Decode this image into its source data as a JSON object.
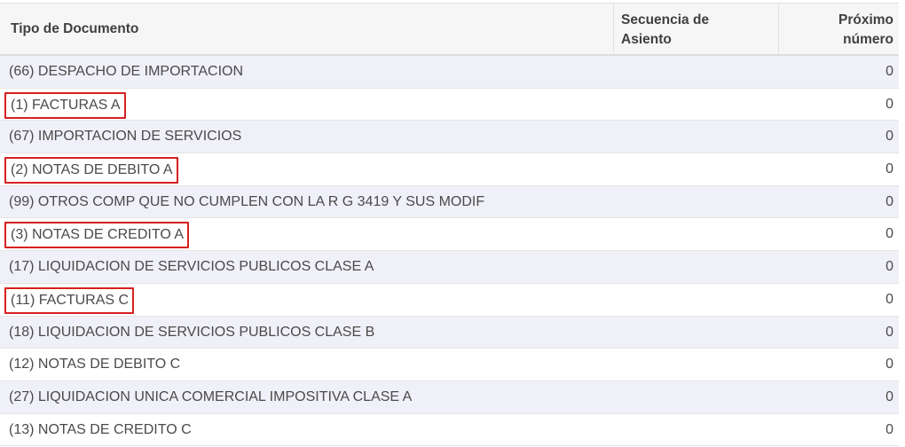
{
  "table": {
    "columns": {
      "doc_type": "Tipo de Documento",
      "sequence": [
        "Secuencia de",
        "Asiento"
      ],
      "next_number": [
        "Próximo",
        "número"
      ]
    },
    "rows": [
      {
        "doc": "(66) DESPACHO DE IMPORTACION",
        "sequence": "",
        "next": "0",
        "highlighted": false
      },
      {
        "doc": "(1) FACTURAS A",
        "sequence": "",
        "next": "0",
        "highlighted": true
      },
      {
        "doc": "(67) IMPORTACION DE SERVICIOS",
        "sequence": "",
        "next": "0",
        "highlighted": false
      },
      {
        "doc": "(2) NOTAS DE DEBITO A",
        "sequence": "",
        "next": "0",
        "highlighted": true
      },
      {
        "doc": "(99) OTROS COMP QUE NO CUMPLEN CON LA R G 3419 Y SUS MODIF",
        "sequence": "",
        "next": "0",
        "highlighted": false
      },
      {
        "doc": "(3) NOTAS DE CREDITO A",
        "sequence": "",
        "next": "0",
        "highlighted": true
      },
      {
        "doc": "(17) LIQUIDACION DE SERVICIOS PUBLICOS CLASE A",
        "sequence": "",
        "next": "0",
        "highlighted": false
      },
      {
        "doc": "(11) FACTURAS C",
        "sequence": "",
        "next": "0",
        "highlighted": true
      },
      {
        "doc": "(18) LIQUIDACION DE SERVICIOS PUBLICOS CLASE B",
        "sequence": "",
        "next": "0",
        "highlighted": false
      },
      {
        "doc": "(12) NOTAS DE DEBITO C",
        "sequence": "",
        "next": "0",
        "highlighted": false
      },
      {
        "doc": "(27) LIQUIDACION UNICA COMERCIAL IMPOSITIVA CLASE A",
        "sequence": "",
        "next": "0",
        "highlighted": false
      },
      {
        "doc": "(13) NOTAS DE CREDITO C",
        "sequence": "",
        "next": "0",
        "highlighted": false
      }
    ]
  },
  "colors": {
    "highlight_border": "#d62020",
    "row_stripe": "#f0f0f8",
    "header_bg": "#f6f6f6"
  }
}
